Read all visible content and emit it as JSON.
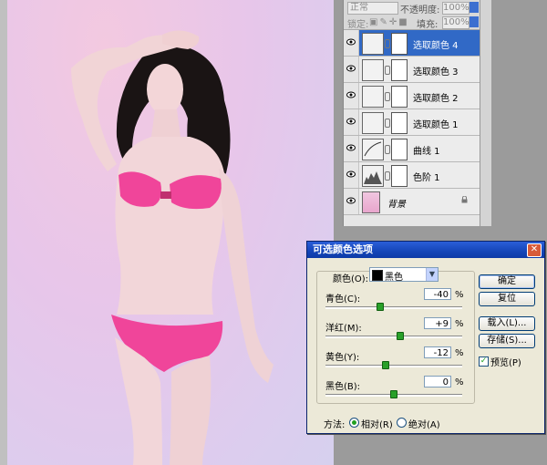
{
  "layers_panel": {
    "blend_mode": "正常",
    "opacity_label": "不透明度:",
    "opacity_value": "100%",
    "lock_label": "锁定:",
    "fill_label": "填充:",
    "fill_value": "100%",
    "layers": [
      {
        "name": "选取颜色 4",
        "selected": true
      },
      {
        "name": "选取颜色 3",
        "selected": false
      },
      {
        "name": "选取颜色 2",
        "selected": false
      },
      {
        "name": "选取颜色 1",
        "selected": false
      },
      {
        "name": "曲线 1",
        "selected": false
      },
      {
        "name": "色阶 1",
        "selected": false
      },
      {
        "name": "背景",
        "selected": false
      }
    ]
  },
  "dialog": {
    "title": "可选颜色选项",
    "close_label": "✕",
    "colors_label": "颜色(O):",
    "selected_color": "黑色",
    "sliders": [
      {
        "label": "青色(C):",
        "value": "-40",
        "unit": "%",
        "fraction": 0.4
      },
      {
        "label": "洋红(M):",
        "value": "+9",
        "unit": "%",
        "fraction": 0.545
      },
      {
        "label": "黄色(Y):",
        "value": "-12",
        "unit": "%",
        "fraction": 0.44
      },
      {
        "label": "黑色(B):",
        "value": "0",
        "unit": "%",
        "fraction": 0.5
      }
    ],
    "buttons": {
      "ok": "确定",
      "reset": "复位",
      "load": "载入(L)...",
      "save": "存储(S)..."
    },
    "preview_label": "预览(P)",
    "preview_checked": true,
    "method_label": "方法:",
    "method_relative": "相对(R)",
    "method_absolute": "绝对(A)",
    "method_selected": "relative"
  },
  "colors": {
    "selection_blue": "#3169c6",
    "titlebar_blue": "#1445b8",
    "dialog_bg": "#ece9d8",
    "slider_thumb": "#29a029",
    "bikini_pink": "#f0459a"
  }
}
